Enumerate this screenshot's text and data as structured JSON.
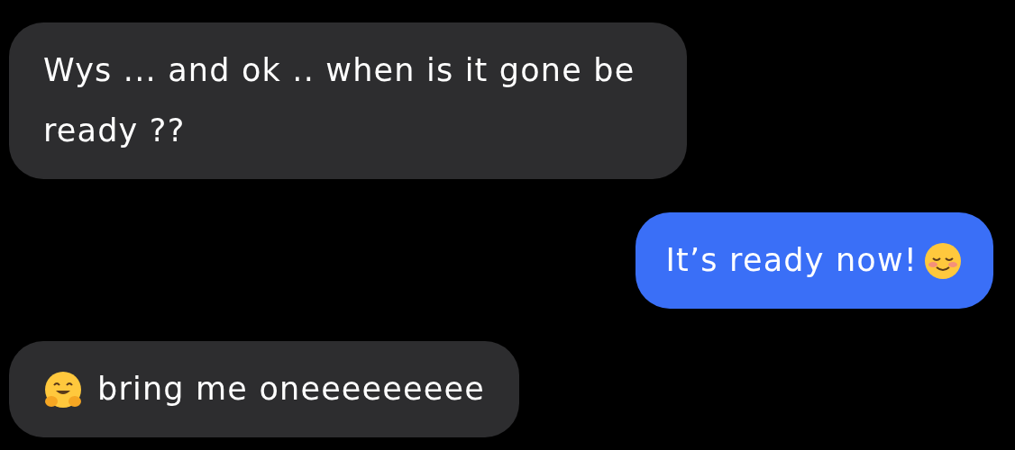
{
  "messages": [
    {
      "sent": false,
      "text": "Wys ... and ok .. when is it gone be ready ??"
    },
    {
      "sent": true,
      "text": "It’s ready now!",
      "icon_after": true
    },
    {
      "sent": false,
      "text": "bring me oneeeeeeeee",
      "icon_before": true
    }
  ]
}
